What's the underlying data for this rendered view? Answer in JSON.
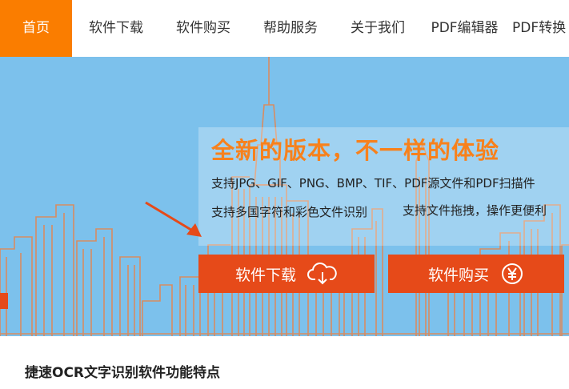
{
  "nav": {
    "items": [
      {
        "label": "首页",
        "active": true
      },
      {
        "label": "软件下载",
        "active": false
      },
      {
        "label": "软件购买",
        "active": false
      },
      {
        "label": "帮助服务",
        "active": false
      },
      {
        "label": "关于我们",
        "active": false
      },
      {
        "label": "PDF编辑器",
        "active": false
      },
      {
        "label": "PDF转换",
        "active": false
      }
    ]
  },
  "banner": {
    "headline": "全新的版本，不一样的体验",
    "feature_line1": "支持JPG、GIF、PNG、BMP、TIF、PDF源文件和PDF扫描件",
    "feature_line2a": "支持多国字符和彩色文件识别",
    "feature_line2b": "支持文件拖拽，操作更便利",
    "download_button": {
      "label": "软件下载",
      "icon": "cloud-download-icon"
    },
    "buy_button": {
      "label": "软件购买",
      "icon": "yen-icon"
    }
  },
  "section": {
    "title": "捷速OCR文字识别软件功能特点"
  },
  "colors": {
    "nav_active": "#fa7d00",
    "banner_bg": "#7cc1ec",
    "headline": "#f7811c",
    "button": "#e64a19",
    "cityline": "#e8834a"
  }
}
